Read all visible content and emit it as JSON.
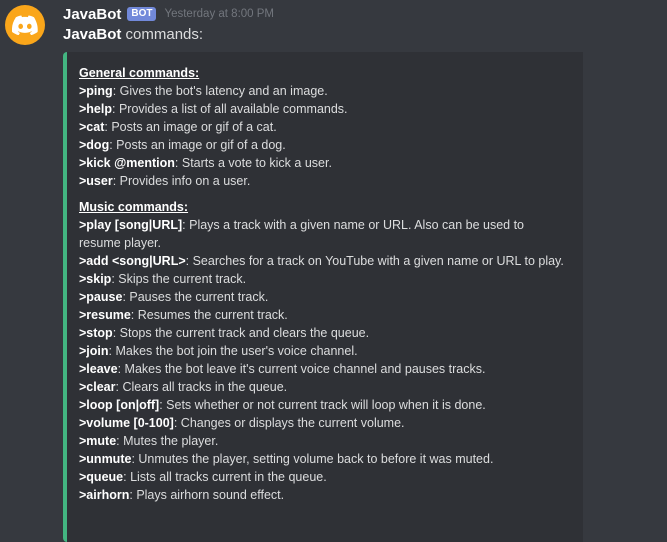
{
  "message": {
    "author": "JavaBot",
    "tag": "BOT",
    "timestamp": "Yesterday at 8:00 PM",
    "content_bold": "JavaBot",
    "content_rest": " commands:",
    "avatar_icon": "discord-logo-icon"
  },
  "colors": {
    "background": "#36393f",
    "embed_background": "#2f3136",
    "embed_border": "#43b581",
    "avatar": "#faa61a",
    "bot_tag": "#7289da"
  },
  "embed": {
    "general_title": "General commands:",
    "general": [
      {
        "cmd": ">ping",
        "desc": ": Gives the bot's latency and an image."
      },
      {
        "cmd": ">help",
        "desc": ": Provides a list of all available commands."
      },
      {
        "cmd": ">cat",
        "desc": ": Posts an image or gif of a cat."
      },
      {
        "cmd": ">dog",
        "desc": ": Posts an image or gif of a dog."
      },
      {
        "cmd": ">kick @mention",
        "desc": ": Starts a vote to kick a user."
      },
      {
        "cmd": ">user",
        "desc": ": Provides info on a user."
      }
    ],
    "music_title": "Music commands:",
    "music": [
      {
        "cmd": ">play [song|URL]",
        "desc": ": Plays a track with a given name or URL. Also can be used to resume player."
      },
      {
        "cmd": ">add <song|URL>",
        "desc": ": Searches for a track on YouTube with a given name or URL to play."
      },
      {
        "cmd": ">skip",
        "desc": ": Skips the current track."
      },
      {
        "cmd": ">pause",
        "desc": ": Pauses the current track."
      },
      {
        "cmd": ">resume",
        "desc": ": Resumes the current track."
      },
      {
        "cmd": ">stop",
        "desc": ": Stops the current track and clears the queue."
      },
      {
        "cmd": ">join",
        "desc": ": Makes the bot join the user's voice channel."
      },
      {
        "cmd": ">leave",
        "desc": ": Makes the bot leave it's current voice channel and pauses tracks."
      },
      {
        "cmd": ">clear",
        "desc": ": Clears all tracks in the queue."
      },
      {
        "cmd": ">loop [on|off]",
        "desc": ": Sets whether or not current track will loop when it is done."
      },
      {
        "cmd": ">volume [0-100]",
        "desc": ": Changes or displays the current volume."
      },
      {
        "cmd": ">mute",
        "desc": ": Mutes the player."
      },
      {
        "cmd": ">unmute",
        "desc": ": Unmutes the player, setting volume back to before it was muted."
      },
      {
        "cmd": ">queue",
        "desc": ": Lists all tracks current in the queue."
      },
      {
        "cmd": ">airhorn",
        "desc": ": Plays airhorn sound effect."
      }
    ]
  }
}
